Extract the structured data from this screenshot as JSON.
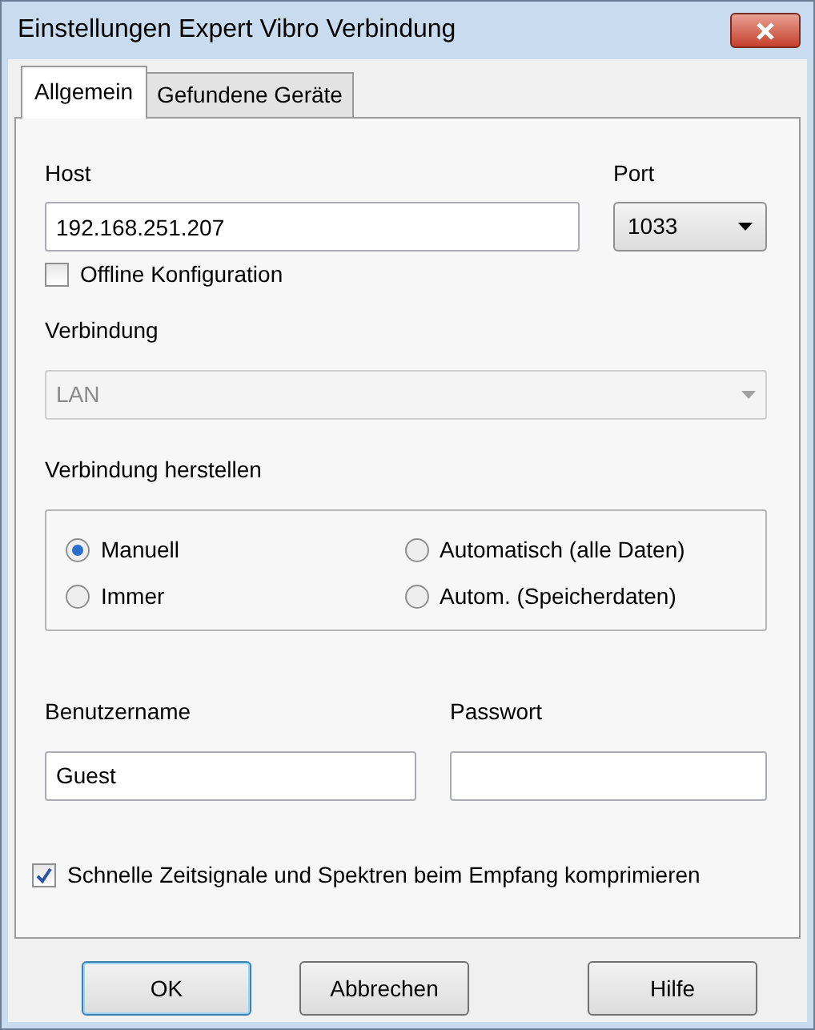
{
  "window": {
    "title": "Einstellungen Expert Vibro Verbindung"
  },
  "tabs": [
    {
      "label": "Allgemein",
      "selected": true
    },
    {
      "label": "Gefundene Geräte",
      "selected": false
    }
  ],
  "host": {
    "label": "Host",
    "value": "192.168.251.207"
  },
  "port": {
    "label": "Port",
    "value": "1033"
  },
  "offline": {
    "label": "Offline Konfiguration",
    "checked": false
  },
  "connection": {
    "label": "Verbindung",
    "value": "LAN",
    "disabled": true
  },
  "connect_mode": {
    "title": "Verbindung herstellen",
    "options": [
      {
        "label": "Manuell",
        "selected": true
      },
      {
        "label": "Automatisch (alle Daten)",
        "selected": false
      },
      {
        "label": "Immer",
        "selected": false
      },
      {
        "label": "Autom. (Speicherdaten)",
        "selected": false
      }
    ]
  },
  "username": {
    "label": "Benutzername",
    "value": "Guest"
  },
  "password": {
    "label": "Passwort"
  },
  "compress": {
    "label": "Schnelle Zeitsignale und Spektren beim Empfang komprimieren",
    "checked": true
  },
  "buttons": [
    {
      "label": "OK",
      "default": true
    },
    {
      "label": "Abbrechen",
      "default": false
    },
    {
      "label": "Hilfe",
      "default": false
    }
  ]
}
